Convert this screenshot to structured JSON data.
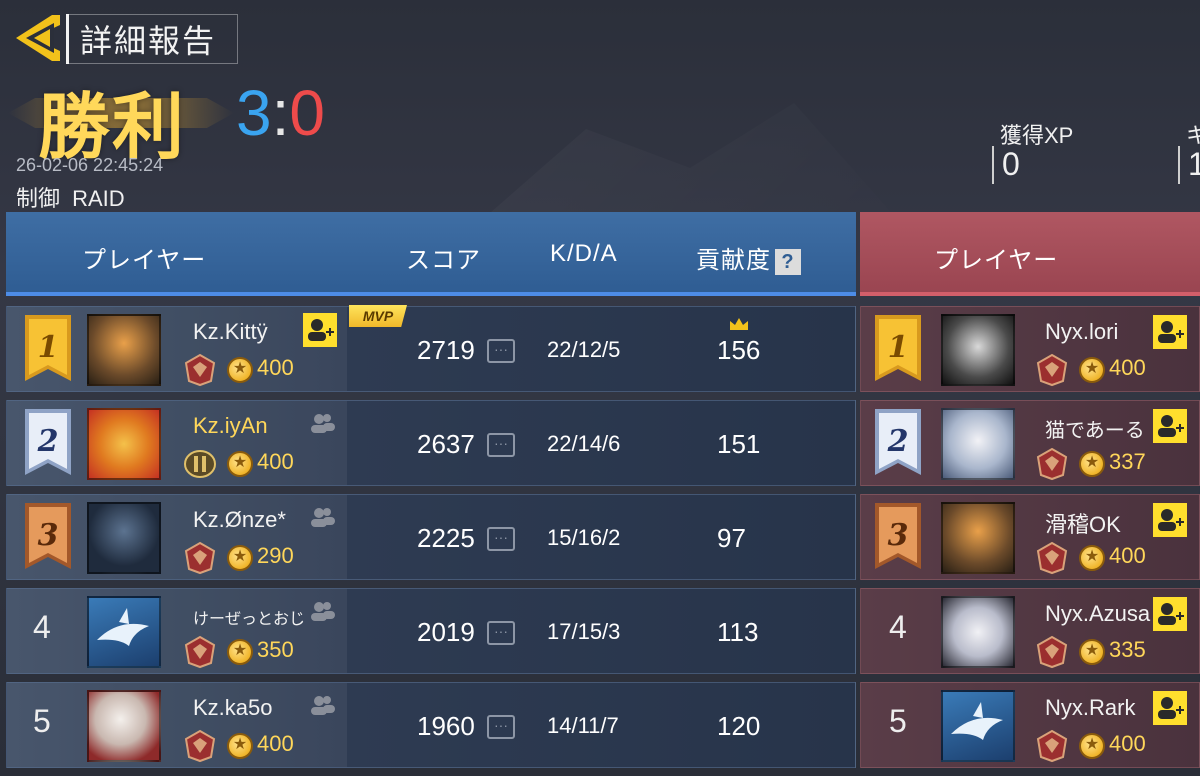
{
  "header": {
    "title": "詳細報告",
    "result": "勝利",
    "score_blue": "3",
    "score_sep": ":",
    "score_red": "0",
    "datetime": "26-02-06 22:45:24",
    "mode": "制御 RAID",
    "xp_label": "獲得XP",
    "xp_value": "0",
    "xp2_label": "キ",
    "xp2_value": "1"
  },
  "columns": {
    "player": "プレイヤー",
    "score": "スコア",
    "kda": "K/D/A",
    "contribution": "貢献度",
    "help": "?",
    "player_red": "プレイヤー"
  },
  "mvp_label": "MVP",
  "blue_team": [
    {
      "rank": "1",
      "name": "Kz.Kittÿ",
      "coins": "400",
      "score": "2719",
      "kda": "22/12/5",
      "contribution": "156"
    },
    {
      "rank": "2",
      "name": "Kz.iyAn",
      "coins": "400",
      "score": "2637",
      "kda": "22/14/6",
      "contribution": "151"
    },
    {
      "rank": "3",
      "name": "Kz.Ønze*",
      "coins": "290",
      "score": "2225",
      "kda": "15/16/2",
      "contribution": "97"
    },
    {
      "rank": "4",
      "name": "けーぜっとおじ",
      "coins": "350",
      "score": "2019",
      "kda": "17/15/3",
      "contribution": "113"
    },
    {
      "rank": "5",
      "name": "Kz.ka5o",
      "coins": "400",
      "score": "1960",
      "kda": "14/11/7",
      "contribution": "120"
    }
  ],
  "red_team": [
    {
      "rank": "1",
      "name": "Nyx.lori",
      "coins": "400"
    },
    {
      "rank": "2",
      "name": "猫であーる",
      "coins": "337"
    },
    {
      "rank": "3",
      "name": "滑稽OK",
      "coins": "400"
    },
    {
      "rank": "4",
      "name": "Nyx.Azusa",
      "coins": "335"
    },
    {
      "rank": "5",
      "name": "Nyx.Rark",
      "coins": "400"
    }
  ],
  "colors": {
    "gold": "#ffd75a",
    "blue_team": "#3aa4f0",
    "red_team": "#ee4b4b",
    "friend_button": "#ffdf2d"
  }
}
